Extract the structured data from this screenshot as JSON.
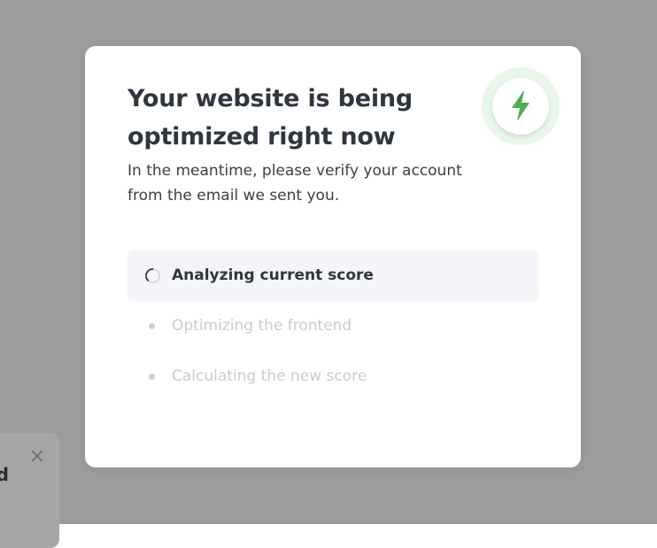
{
  "modal": {
    "title": "Your website is being optimized right now",
    "subtitle": "In the meantime, please verify your account from the email we sent you.",
    "badge_icon": "lightning-bolt-icon",
    "badge_color": "#4caf50"
  },
  "steps": [
    {
      "label": "Analyzing current score",
      "state": "active",
      "icon": "spinner-icon"
    },
    {
      "label": "Optimizing the frontend",
      "state": "pending",
      "icon": "dot-icon"
    },
    {
      "label": "Calculating the new score",
      "state": "pending",
      "icon": "dot-icon"
    }
  ],
  "background_toast": {
    "close_icon": "close-icon",
    "close_glyph": "×",
    "partial_text": "d"
  },
  "colors": {
    "overlay": "#9c9c9c",
    "modal_bg": "#ffffff",
    "title": "#2f3640",
    "active_step_bg": "#f4f5f9",
    "pending_text": "#cbcbcb",
    "accent_green": "#4caf50"
  }
}
